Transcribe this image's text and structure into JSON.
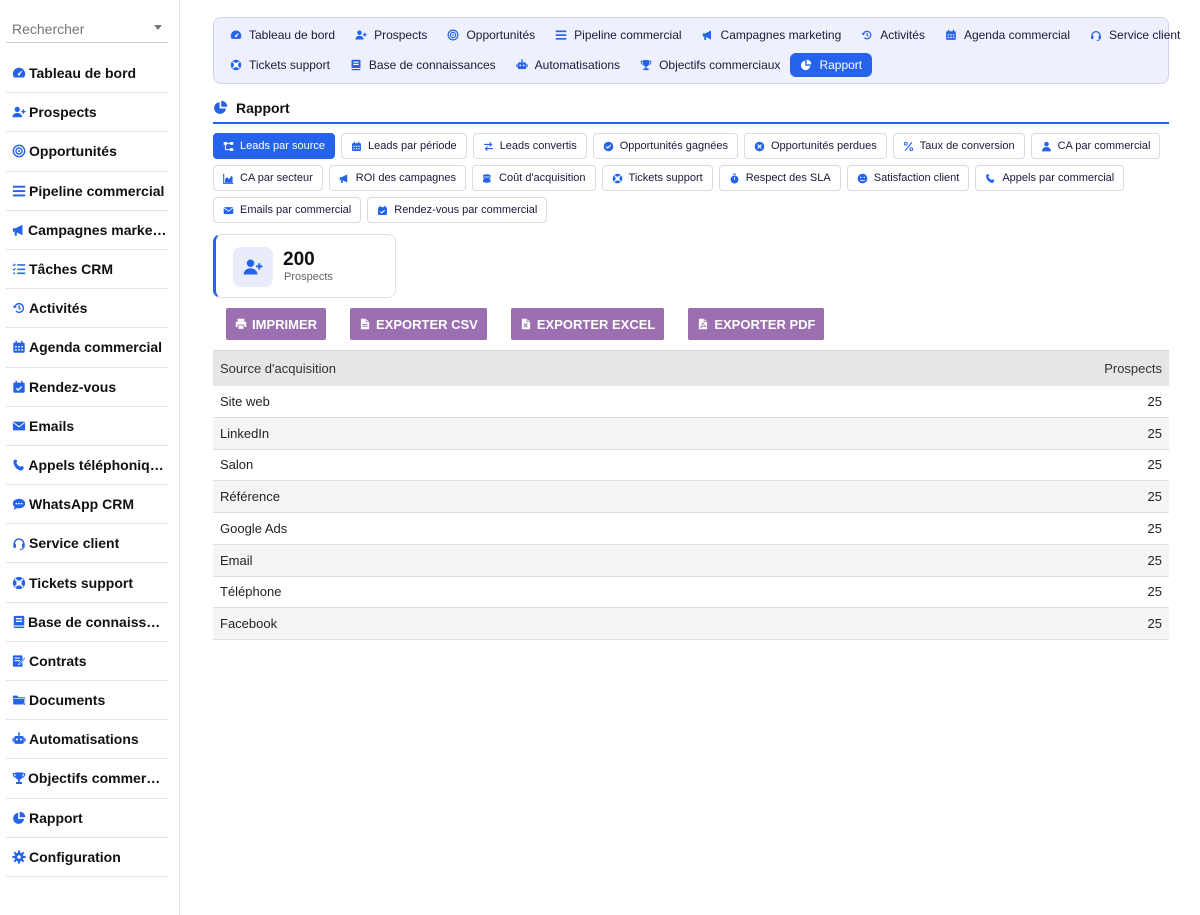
{
  "colors": {
    "accent": "#2563eb",
    "export": "#9b6fb0",
    "topbar_bg": "#eef0fd"
  },
  "search": {
    "placeholder": "Rechercher"
  },
  "sidebar": {
    "items": [
      {
        "label": "Tableau de bord",
        "icon": "gauge-icon"
      },
      {
        "label": "Prospects",
        "icon": "user-plus-icon"
      },
      {
        "label": "Opportunités",
        "icon": "bullseye-icon"
      },
      {
        "label": "Pipeline commercial",
        "icon": "bars-icon"
      },
      {
        "label": "Campagnes marketing",
        "icon": "megaphone-icon"
      },
      {
        "label": "Tâches CRM",
        "icon": "list-check-icon"
      },
      {
        "label": "Activités",
        "icon": "history-icon"
      },
      {
        "label": "Agenda commercial",
        "icon": "calendar-icon"
      },
      {
        "label": "Rendez-vous",
        "icon": "calendar-check-icon"
      },
      {
        "label": "Emails",
        "icon": "envelope-icon"
      },
      {
        "label": "Appels téléphoniques",
        "icon": "phone-icon"
      },
      {
        "label": "WhatsApp CRM",
        "icon": "chat-icon"
      },
      {
        "label": "Service client",
        "icon": "headset-icon"
      },
      {
        "label": "Tickets support",
        "icon": "lifebuoy-icon"
      },
      {
        "label": "Base de connaissances",
        "icon": "book-icon"
      },
      {
        "label": "Contrats",
        "icon": "contract-icon"
      },
      {
        "label": "Documents",
        "icon": "folder-icon"
      },
      {
        "label": "Automatisations",
        "icon": "robot-icon"
      },
      {
        "label": "Objectifs commerciaux",
        "icon": "trophy-icon"
      },
      {
        "label": "Rapport",
        "icon": "pie-chart-icon"
      },
      {
        "label": "Configuration",
        "icon": "gear-icon"
      }
    ]
  },
  "topnav": {
    "row1": [
      {
        "label": "Tableau de bord",
        "icon": "gauge-icon"
      },
      {
        "label": "Prospects",
        "icon": "user-plus-icon"
      },
      {
        "label": "Opportunités",
        "icon": "bullseye-icon"
      },
      {
        "label": "Pipeline commercial",
        "icon": "bars-icon"
      },
      {
        "label": "Campagnes marketing",
        "icon": "megaphone-icon"
      },
      {
        "label": "Activités",
        "icon": "history-icon"
      },
      {
        "label": "Agenda commercial",
        "icon": "calendar-icon"
      },
      {
        "label": "Service client",
        "icon": "headset-icon"
      }
    ],
    "row2": [
      {
        "label": "Tickets support",
        "icon": "lifebuoy-icon"
      },
      {
        "label": "Base de connaissances",
        "icon": "book-icon"
      },
      {
        "label": "Automatisations",
        "icon": "robot-icon"
      },
      {
        "label": "Objectifs commerciaux",
        "icon": "trophy-icon"
      },
      {
        "label": "Rapport",
        "icon": "pie-chart-icon",
        "active": true
      }
    ]
  },
  "section": {
    "title": "Rapport",
    "icon": "pie-chart-icon"
  },
  "reports": {
    "row1": [
      {
        "label": "Leads par source",
        "icon": "sitemap-icon",
        "active": true
      },
      {
        "label": "Leads par période",
        "icon": "calendar-icon"
      },
      {
        "label": "Leads convertis",
        "icon": "exchange-icon"
      },
      {
        "label": "Opportunités gagnées",
        "icon": "check-circle-icon"
      },
      {
        "label": "Opportunités perdues",
        "icon": "times-circle-icon"
      },
      {
        "label": "Taux de conversion",
        "icon": "percent-icon"
      },
      {
        "label": "CA par commercial",
        "icon": "user-icon"
      }
    ],
    "row2": [
      {
        "label": "CA par secteur",
        "icon": "area-chart-icon"
      },
      {
        "label": "ROI des campagnes",
        "icon": "megaphone-icon"
      },
      {
        "label": "Coût d'acquisition",
        "icon": "coins-icon"
      },
      {
        "label": "Tickets support",
        "icon": "lifebuoy-icon"
      },
      {
        "label": "Respect des SLA",
        "icon": "stopwatch-icon"
      },
      {
        "label": "Satisfaction client",
        "icon": "smile-icon"
      },
      {
        "label": "Appels par commercial",
        "icon": "phone-icon"
      }
    ],
    "row3": [
      {
        "label": "Emails par commercial",
        "icon": "envelope-icon"
      },
      {
        "label": "Rendez-vous par commercial",
        "icon": "calendar-check-icon"
      }
    ]
  },
  "stat": {
    "value": "200",
    "label": "Prospects",
    "icon": "user-plus-icon"
  },
  "exports": [
    {
      "label": "IMPRIMER",
      "icon": "print-icon"
    },
    {
      "label": "EXPORTER CSV",
      "icon": "file-csv-icon"
    },
    {
      "label": "EXPORTER EXCEL",
      "icon": "file-excel-icon"
    },
    {
      "label": "EXPORTER PDF",
      "icon": "file-pdf-icon"
    }
  ],
  "table": {
    "headers": [
      "Source d'acquisition",
      "Prospects"
    ],
    "rows": [
      [
        "Site web",
        "25"
      ],
      [
        "LinkedIn",
        "25"
      ],
      [
        "Salon",
        "25"
      ],
      [
        "Référence",
        "25"
      ],
      [
        "Google Ads",
        "25"
      ],
      [
        "Email",
        "25"
      ],
      [
        "Téléphone",
        "25"
      ],
      [
        "Facebook",
        "25"
      ]
    ]
  }
}
